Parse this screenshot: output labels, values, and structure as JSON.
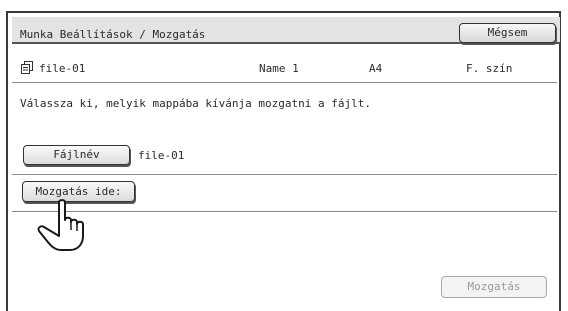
{
  "header": {
    "title": "Munka Beállítások / Mozgatás",
    "cancel_label": "Mégsem"
  },
  "file_info": {
    "file_name": "file-01",
    "user": "Name 1",
    "paper_size": "A4",
    "color_mode": "F. szín"
  },
  "instruction": "Válassza ki, melyik mappába kívánja mozgatni a fájlt.",
  "filename_field": {
    "button_label": "Fájlnév",
    "value": "file-01"
  },
  "destination": {
    "button_label": "Mozgatás ide:"
  },
  "actions": {
    "move_label": "Mozgatás"
  }
}
